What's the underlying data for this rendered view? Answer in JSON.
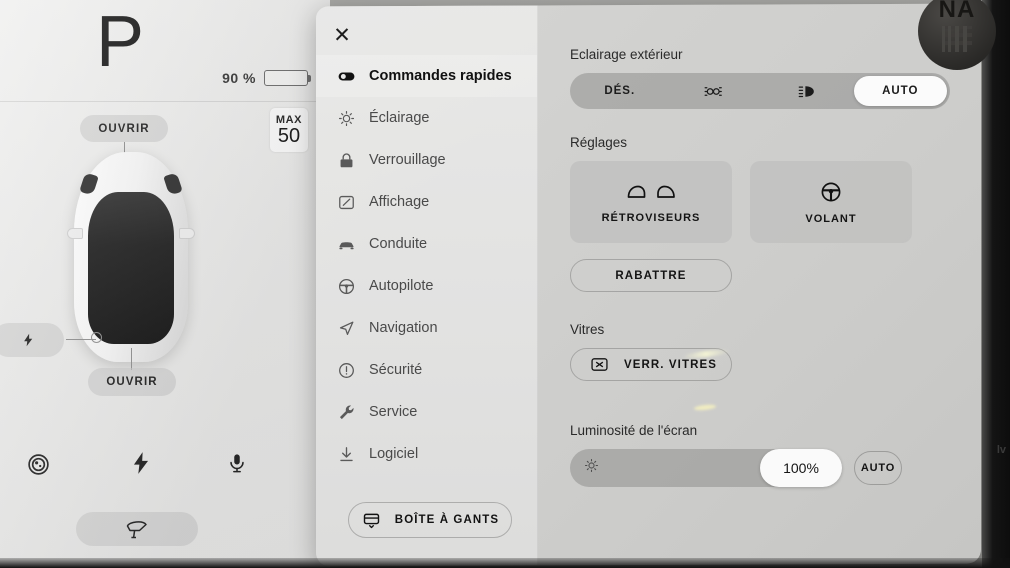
{
  "vehicle_pane": {
    "gear": "P",
    "battery_percent_label": "90 %",
    "battery_level": 90,
    "speed_limit": {
      "max_label": "MAX",
      "value": "50"
    },
    "frunk_button": "OUVRIR",
    "trunk_button": "OUVRIR",
    "charge_icon": "bolt-icon",
    "quick_icons": [
      {
        "name": "dashcam-icon",
        "label": "Caméra"
      },
      {
        "name": "charge-bolt-icon",
        "label": "Charge"
      },
      {
        "name": "microphone-icon",
        "label": "Micro"
      }
    ],
    "wiper_icon": "windshield-wiper-icon"
  },
  "modal": {
    "close_icon": "close-icon",
    "sidebar": {
      "items": [
        {
          "label": "Commandes rapides",
          "icon": "toggle-filled-icon",
          "active": true
        },
        {
          "label": "Éclairage",
          "icon": "lightbulb-icon",
          "active": false
        },
        {
          "label": "Verrouillage",
          "icon": "lock-icon",
          "active": false
        },
        {
          "label": "Affichage",
          "icon": "display-icon",
          "active": false
        },
        {
          "label": "Conduite",
          "icon": "car-icon",
          "active": false
        },
        {
          "label": "Autopilote",
          "icon": "steering-wheel-icon",
          "active": false
        },
        {
          "label": "Navigation",
          "icon": "navigation-arrow-icon",
          "active": false
        },
        {
          "label": "Sécurité",
          "icon": "alert-circle-icon",
          "active": false
        },
        {
          "label": "Service",
          "icon": "wrench-icon",
          "active": false
        },
        {
          "label": "Logiciel",
          "icon": "download-icon",
          "active": false
        }
      ],
      "glovebox_button": {
        "label": "BOÎTE À GANTS",
        "icon": "glovebox-icon"
      }
    },
    "content": {
      "exterior_lighting": {
        "label": "Eclairage extérieur",
        "options": [
          {
            "label": "DÉS.",
            "icon": null,
            "selected": false
          },
          {
            "label": "",
            "icon": "parking-lights-icon",
            "selected": false
          },
          {
            "label": "",
            "icon": "low-beam-headlight-icon",
            "selected": false
          },
          {
            "label": "AUTO",
            "icon": null,
            "selected": true
          }
        ]
      },
      "settings": {
        "label": "Réglages",
        "tiles": [
          {
            "label": "RÉTROVISEURS",
            "icon": "mirrors-icon"
          },
          {
            "label": "VOLANT",
            "icon": "steering-wheel-icon"
          }
        ],
        "fold_button": "RABATTRE"
      },
      "windows": {
        "label": "Vitres",
        "lock_button": {
          "label": "VERR. VITRES",
          "icon": "window-lock-icon"
        }
      },
      "brightness": {
        "label": "Luminosité de l'écran",
        "value_label": "100%",
        "value": 100,
        "auto_label": "AUTO",
        "icon": "sun-brightness-icon"
      }
    }
  },
  "photo_overlay": {
    "badge_text": "NA",
    "edge_text": "lv"
  },
  "colors": {
    "battery_green": "#25d60a",
    "panel_bg": "#d1d1cf",
    "sidebar_bg": "#e9e9e8",
    "accent_selected": "#fbfbfb"
  }
}
